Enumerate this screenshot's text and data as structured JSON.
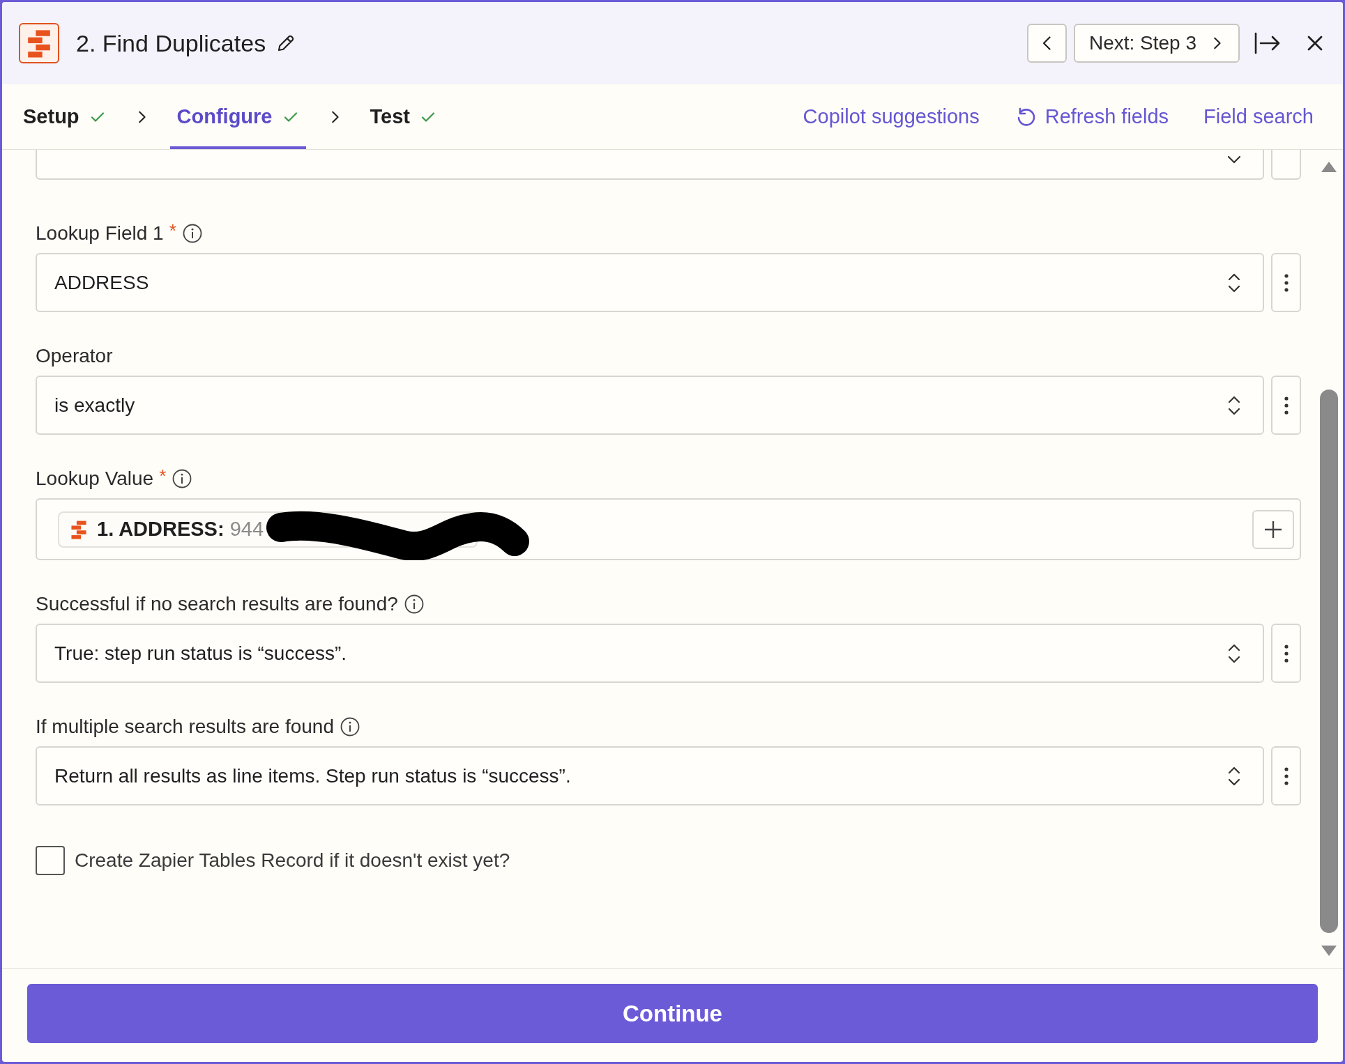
{
  "header": {
    "title": "2. Find Duplicates",
    "next_label": "Next: Step 3"
  },
  "tabs": [
    {
      "label": "Setup",
      "selected": false,
      "complete": true
    },
    {
      "label": "Configure",
      "selected": true,
      "complete": true
    },
    {
      "label": "Test",
      "selected": false,
      "complete": true
    }
  ],
  "actions": [
    {
      "label": "Copilot suggestions",
      "kind": "plain"
    },
    {
      "label": "Refresh fields",
      "kind": "refresh"
    },
    {
      "label": "Field search",
      "kind": "plain"
    }
  ],
  "fields": [
    {
      "kind": "select",
      "label": "Lookup Field 1",
      "required_mark": "*",
      "info": true,
      "value": "ADDRESS"
    },
    {
      "kind": "select",
      "label": "Operator",
      "value": "is exactly"
    },
    {
      "kind": "token",
      "label": "Lookup Value",
      "required_mark": "*",
      "info": true,
      "token_label": "1. ADDRESS:",
      "token_value": "944"
    },
    {
      "kind": "select",
      "label": "Successful if no search results are found?",
      "info": true,
      "value": "True: step run status is “success”."
    },
    {
      "kind": "select",
      "label": "If multiple search results are found",
      "info": true,
      "value": "Return all results as line items. Step run status is “success”."
    }
  ],
  "checkbox": {
    "label": "Create Zapier Tables Record if it doesn't exist yet?",
    "checked": false
  },
  "footer": {
    "button": "Continue"
  }
}
